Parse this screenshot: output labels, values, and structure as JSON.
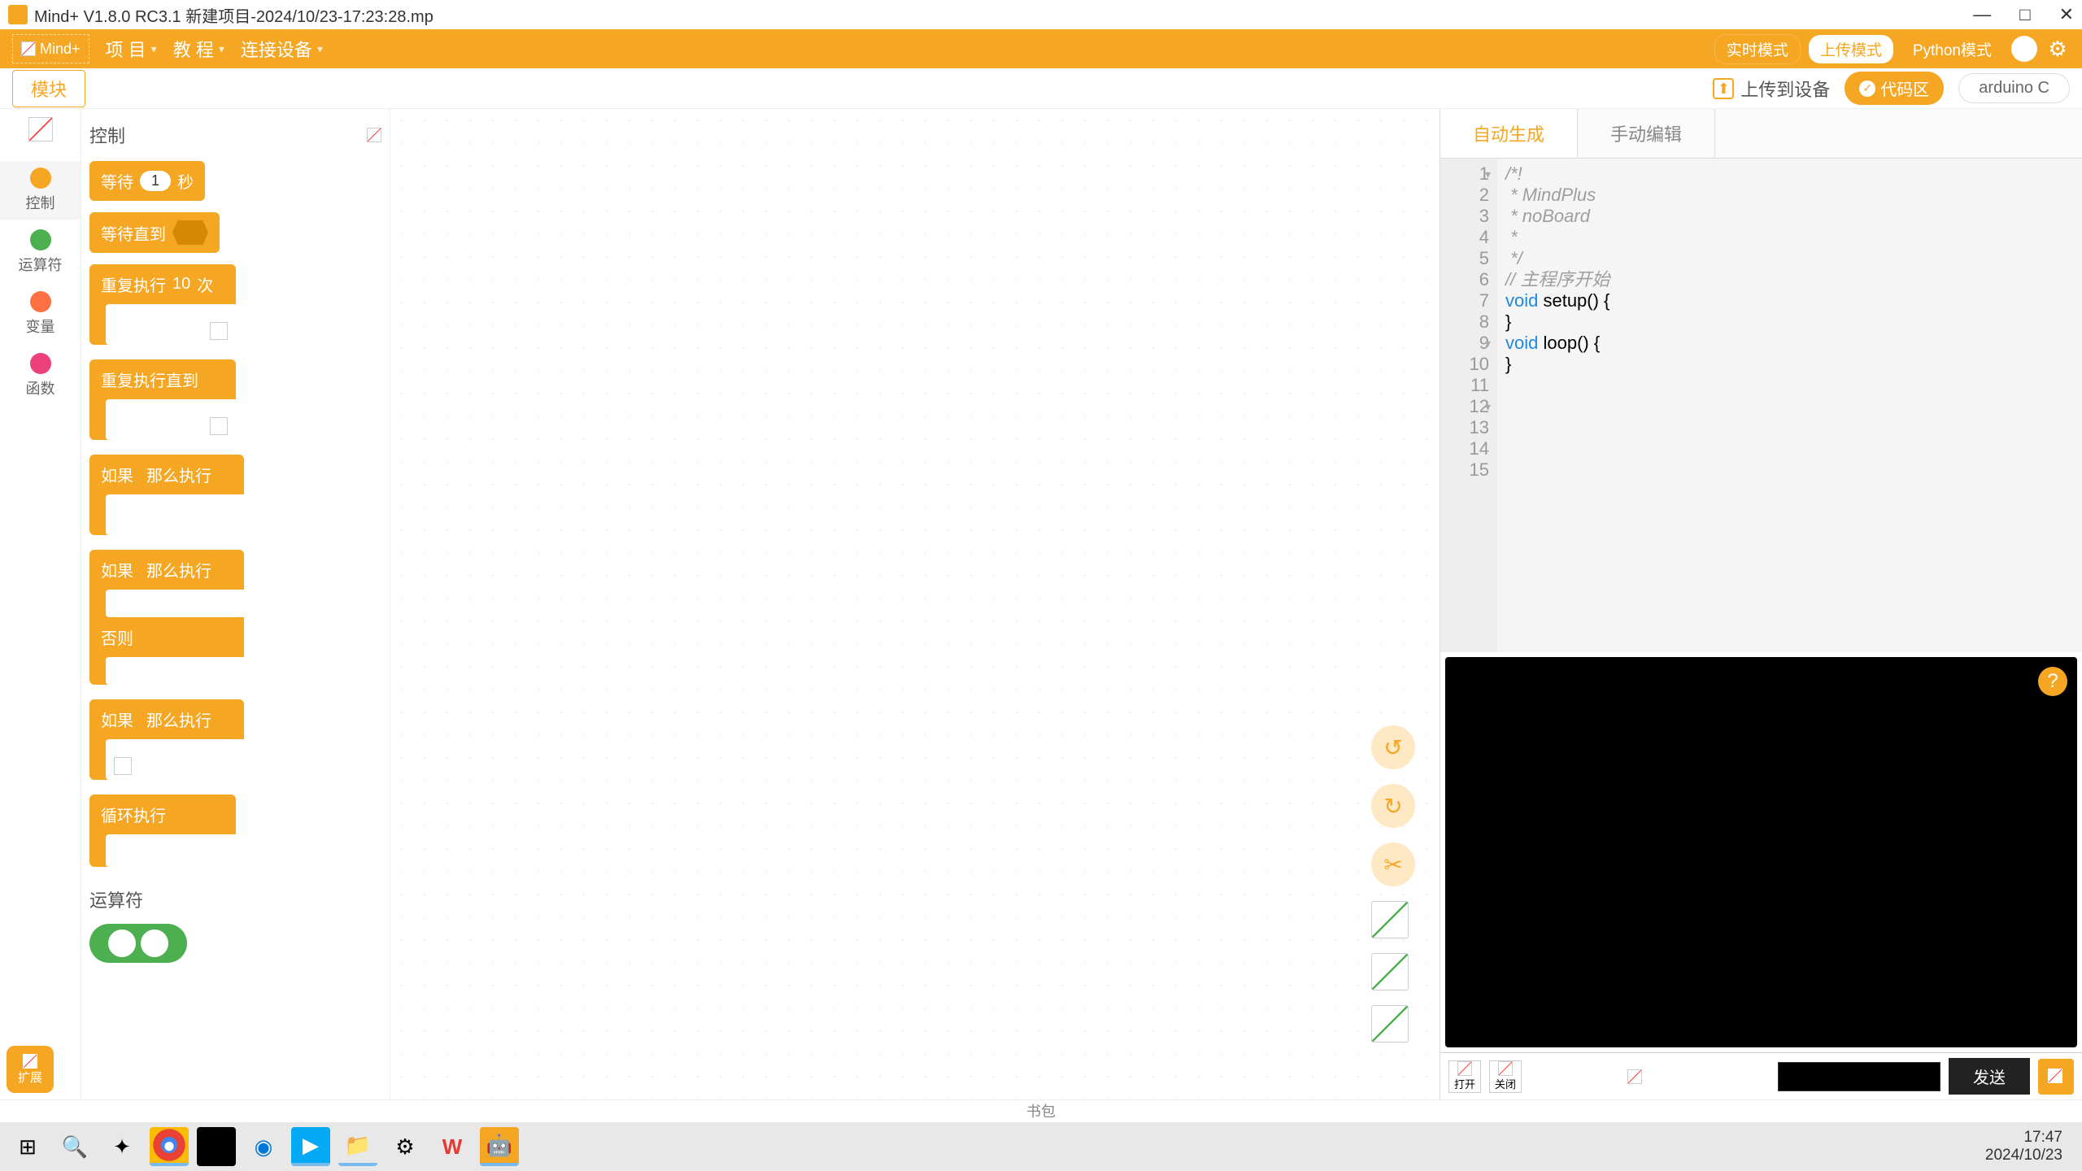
{
  "titlebar": {
    "title": "Mind+ V1.8.0 RC3.1   新建项目-2024/10/23-17:23:28.mp"
  },
  "menu": {
    "logo": "Mind+",
    "project": "项 目",
    "tutorial": "教 程",
    "connect": "连接设备",
    "realtime": "实时模式",
    "upload": "上传模式",
    "python": "Python模式"
  },
  "subbar": {
    "module": "模块",
    "upload_dev": "上传到设备",
    "code_area": "代码区",
    "arduino": "arduino C"
  },
  "categories": [
    {
      "label": "控制",
      "color": "#f5a623",
      "selected": true
    },
    {
      "label": "运算符",
      "color": "#4caf50",
      "selected": false
    },
    {
      "label": "变量",
      "color": "#ff7043",
      "selected": false
    },
    {
      "label": "函数",
      "color": "#ec407a",
      "selected": false
    }
  ],
  "palette": {
    "title": "控制",
    "wait_label_pre": "等待",
    "wait_val": "1",
    "wait_label_post": "秒",
    "wait_until": "等待直到",
    "repeat_label_pre": "重复执行",
    "repeat_val": "10",
    "repeat_label_post": "次",
    "repeat_until": "重复执行直到",
    "if_then": "如果",
    "then_exec": "那么执行",
    "else_label": "否则",
    "loop_exec": "循环执行",
    "operators_title": "运算符"
  },
  "ext": {
    "label": "扩展"
  },
  "code_tabs": {
    "auto": "自动生成",
    "manual": "手动编辑"
  },
  "code": {
    "l1": "/*!",
    "l2": " * MindPlus",
    "l3": " * noBoard",
    "l4": " *",
    "l5": " */",
    "l6": "",
    "l7": "",
    "l8": "// 主程序开始",
    "l9_a": "void",
    "l9_b": " setup() {",
    "l10": "",
    "l11": "}",
    "l12_a": "void",
    "l12_b": " loop() {",
    "l13": "",
    "l14": "}",
    "l15": ""
  },
  "terminal": {
    "send": "发送",
    "open": "打开",
    "close": "关闭"
  },
  "footer": {
    "backpack": "书包"
  },
  "taskbar": {
    "time": "17:47",
    "date": "2024/10/23"
  }
}
